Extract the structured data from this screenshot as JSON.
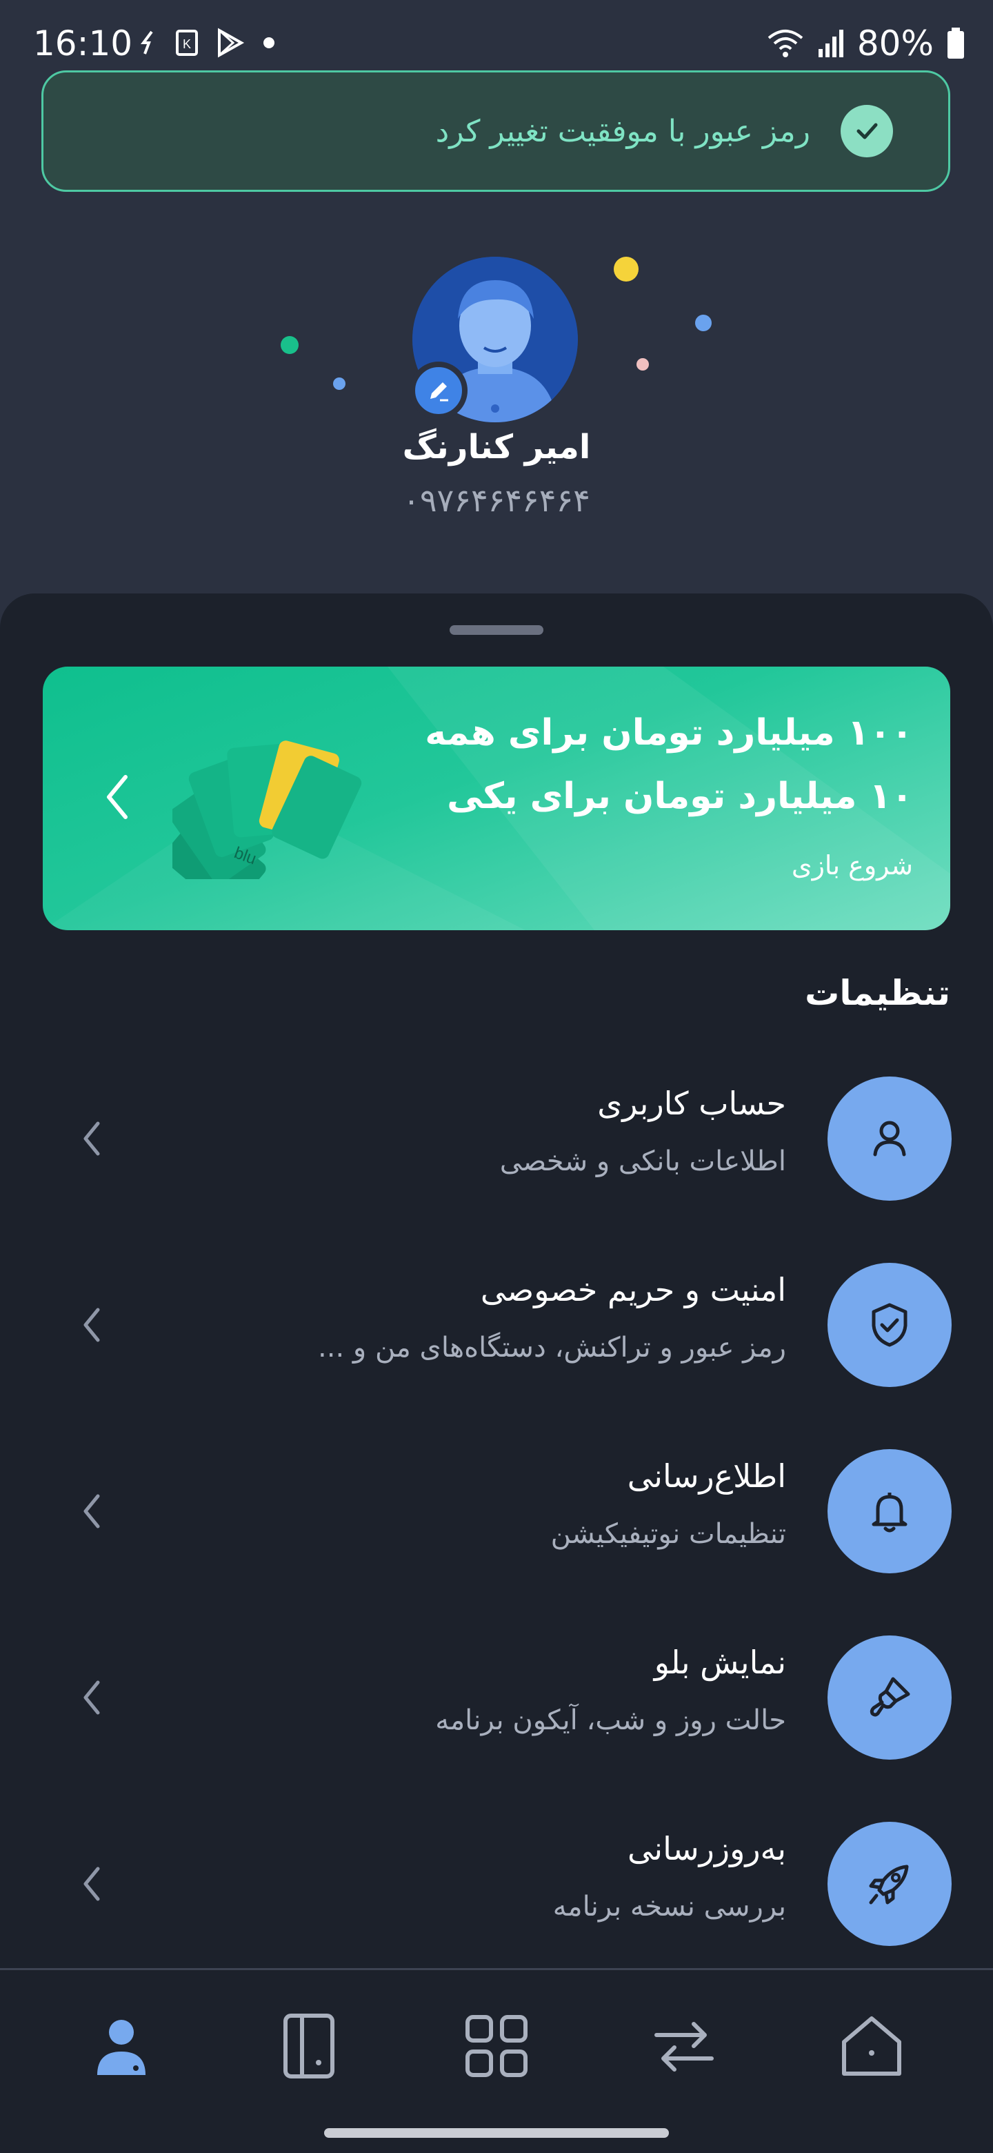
{
  "status_bar": {
    "time": "16:10",
    "battery": "80%",
    "icons": [
      "sync-icon",
      "notification-k-icon",
      "play-store-icon",
      "dot-icon",
      "wifi-icon",
      "signal-icon",
      "battery-icon"
    ]
  },
  "toast": {
    "message": "رمز عبور با موفقیت تغییر کرد",
    "icon": "check-icon",
    "color": "#7fe3c4"
  },
  "profile": {
    "name": "امیر کنارنگ",
    "phone": "۰۹۷۶۴۶۴۶۴۶۴"
  },
  "banner": {
    "title_line1": "۱۰۰ میلیارد تومان برای همه",
    "title_line2": "۱۰ میلیارد تومان برای یکی",
    "cta": "شروع بازی",
    "card_label": "blu",
    "colors": {
      "start": "#0fbf8e",
      "end": "#6fddc0"
    }
  },
  "settings": {
    "section_title": "تنظیمات",
    "items": [
      {
        "title": "حساب کاربری",
        "subtitle": "اطلاعات بانکی و شخصی",
        "icon": "user-icon"
      },
      {
        "title": "امنیت و حریم خصوصی",
        "subtitle": "رمز عبور و تراکنش، دستگاه‌های من و ...",
        "icon": "shield-check-icon"
      },
      {
        "title": "اطلاع‌رسانی",
        "subtitle": "تنظیمات نوتیفیکیشن",
        "icon": "bell-icon"
      },
      {
        "title": "نمایش بلو",
        "subtitle": "حالت روز و شب، آیکون برنامه",
        "icon": "paint-brush-icon"
      },
      {
        "title": "به‌روزرسانی",
        "subtitle": "بررسی نسخه برنامه",
        "icon": "rocket-icon"
      }
    ]
  },
  "bottom_nav": {
    "items": [
      {
        "icon": "profile-icon",
        "active": true
      },
      {
        "icon": "cards-icon",
        "active": false
      },
      {
        "icon": "services-grid-icon",
        "active": false
      },
      {
        "icon": "transfer-icon",
        "active": false
      },
      {
        "icon": "home-icon",
        "active": false
      }
    ],
    "active_color": "#77a9ee"
  }
}
